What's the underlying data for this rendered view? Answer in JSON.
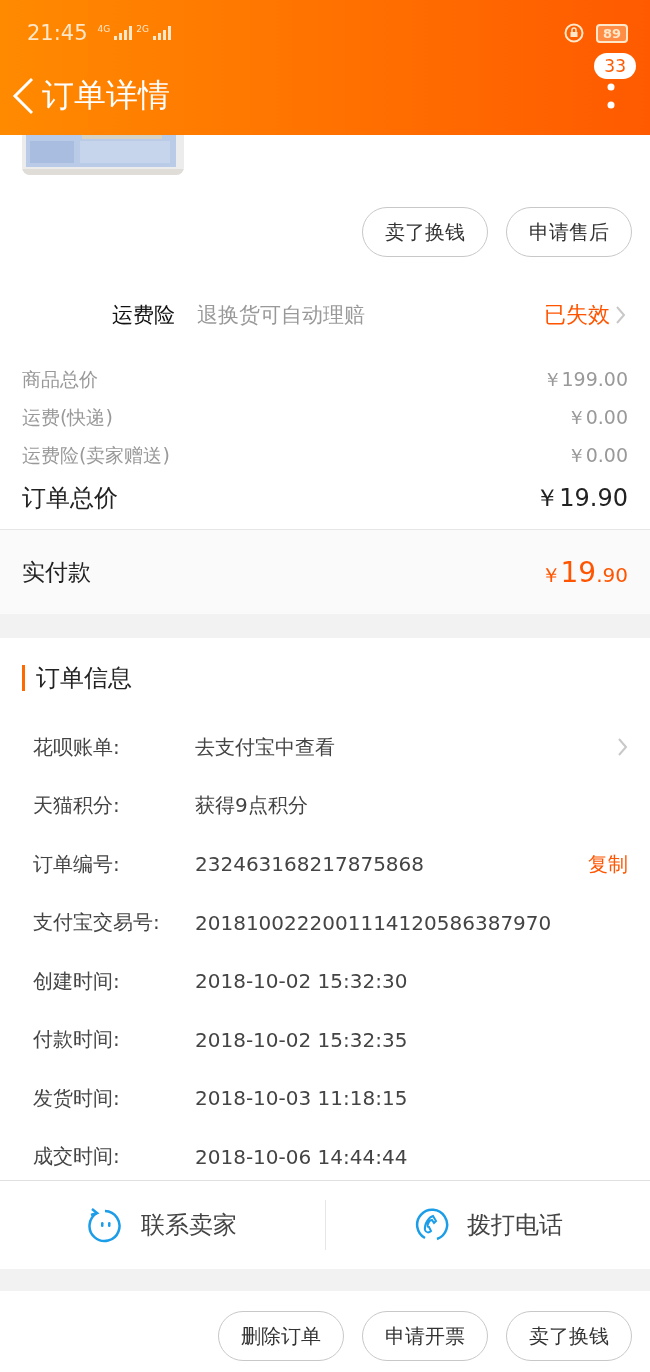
{
  "status_bar": {
    "time": "21:45",
    "network_1": "4G",
    "network_2": "2G",
    "battery": "89"
  },
  "header": {
    "title": "订单详情",
    "badge": "33"
  },
  "top_actions": [
    "卖了换钱",
    "申请售后"
  ],
  "insurance": {
    "name": "运费险",
    "description": "退换货可自动理赔",
    "status": "已失效"
  },
  "price_lines": [
    {
      "label": "商品总价",
      "value": "￥199.00",
      "kind": "minor"
    },
    {
      "label": "运费(快递)",
      "value": "￥0.00",
      "kind": "minor"
    },
    {
      "label": "运费险(卖家赠送)",
      "value": "￥0.00",
      "kind": "minor"
    },
    {
      "label": "订单总价",
      "value": "￥19.90",
      "kind": "total"
    }
  ],
  "paid": {
    "label": "实付款",
    "currency": "￥",
    "integer": "19",
    "decimal": ".90"
  },
  "order_info": {
    "title": "订单信息",
    "rows": [
      {
        "label": "花呗账单:",
        "value": "去支付宝中查看",
        "action": "",
        "kind": "link"
      },
      {
        "label": "天猫积分:",
        "value": "获得9点积分",
        "kind": "plain"
      },
      {
        "label": "订单编号:",
        "value": "232463168217875868",
        "action": "复制",
        "kind": "copy"
      },
      {
        "label": "支付宝交易号:",
        "value": "2018100222001114120586387970",
        "kind": "plain"
      },
      {
        "label": "创建时间:",
        "value": "2018-10-02 15:32:30",
        "kind": "plain"
      },
      {
        "label": "付款时间:",
        "value": "2018-10-02 15:32:35",
        "kind": "plain"
      },
      {
        "label": "发货时间:",
        "value": "2018-10-03 11:18:15",
        "kind": "plain"
      },
      {
        "label": "成交时间:",
        "value": "2018-10-06 14:44:44",
        "kind": "plain"
      }
    ]
  },
  "contact": [
    {
      "label": "联系卖家",
      "kind": "chat"
    },
    {
      "label": "拨打电话",
      "kind": "phone"
    }
  ],
  "bottom_actions": [
    "删除订单",
    "申请开票",
    "卖了换钱"
  ]
}
